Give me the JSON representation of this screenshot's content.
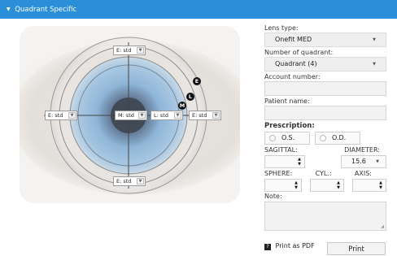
{
  "header": {
    "title": "Quadrant Specific",
    "icon": "triangle-down-icon"
  },
  "eye": {
    "selects": {
      "top": "E: std",
      "left": "E: std",
      "center_m": "M: std",
      "center_l": "L: std",
      "right": "E: std",
      "bottom": "E: std"
    },
    "markers": {
      "e": "E",
      "l": "L",
      "m": "M"
    }
  },
  "form": {
    "lens_type_label": "Lens type:",
    "lens_type_value": "Onefit MED",
    "quadrant_label": "Number of quadrant:",
    "quadrant_value": "Quadrant (4)",
    "account_label": "Account number:",
    "account_value": "",
    "patient_label": "Patient name:",
    "patient_value": "",
    "prescription_label": "Prescription:",
    "os_label": "O.S.",
    "od_label": "O.D.",
    "sagittal_label": "SAGITTAL:",
    "diameter_label": "DIAMETER:",
    "diameter_value": "15.6",
    "sphere_label": "SPHERE:",
    "cyl_label": "CYL.:",
    "axis_label": "AXIS:",
    "note_label": "Note:"
  },
  "footer": {
    "print_pdf_label": "Print as PDF",
    "print_button": "Print"
  }
}
